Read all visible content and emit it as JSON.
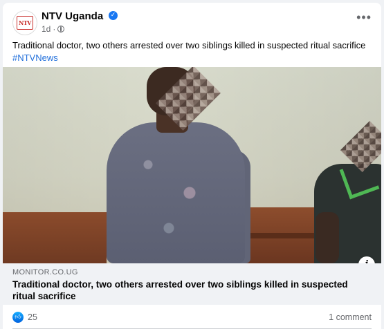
{
  "post": {
    "page_name": "NTV Uganda",
    "avatar_text": "NTV",
    "time": "1d",
    "separator": "·",
    "more_label": "•••",
    "text": "Traditional doctor, two others arrested over two siblings killed in suspected ritual sacrifice",
    "hashtag": "#NTVNews"
  },
  "link_preview": {
    "domain": "MONITOR.CO.UG",
    "title": "Traditional doctor, two others arrested over two siblings killed in suspected ritual sacrifice",
    "info_label": "i"
  },
  "footer": {
    "reaction_count": "25",
    "comments": "1 comment"
  },
  "icons": {
    "verified": "verified-badge-icon",
    "privacy": "globe-icon",
    "reaction": "like-icon",
    "more": "more-options-icon",
    "info": "info-icon"
  },
  "colors": {
    "accent": "#1877f2",
    "hashtag": "#216fdb",
    "secondary_text": "#65676b",
    "link_bg": "#f0f2f5"
  }
}
